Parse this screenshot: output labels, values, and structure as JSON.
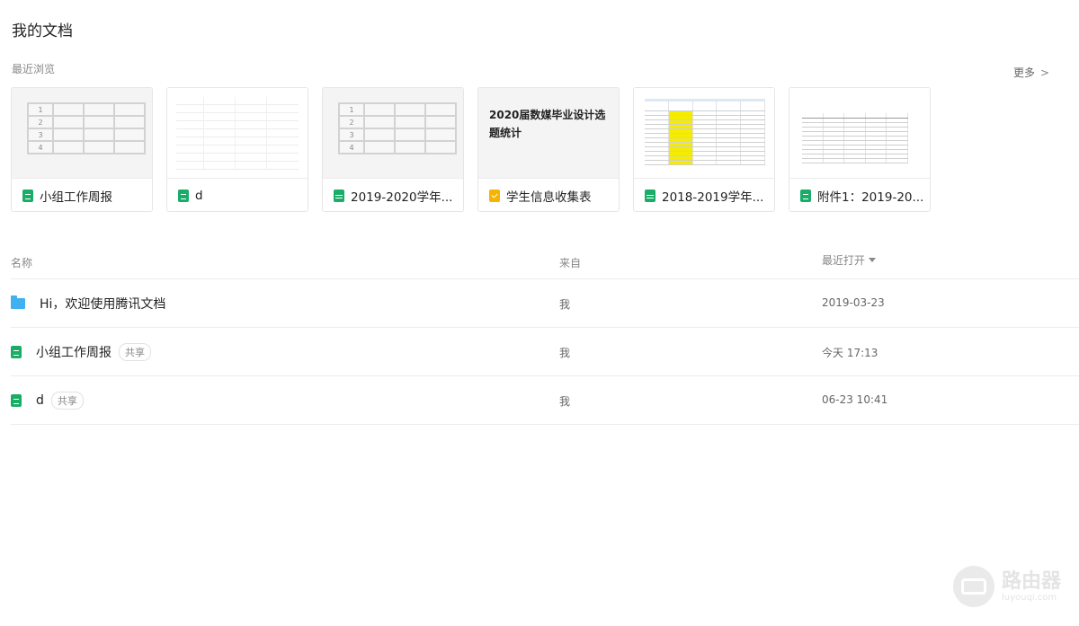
{
  "page_title": "我的文档",
  "recent": {
    "label": "最近浏览",
    "more": "更多",
    "cards": [
      {
        "name": "小组工作周报",
        "icon": "sheet-icon"
      },
      {
        "name": "d",
        "icon": "sheet-icon"
      },
      {
        "name": "2019-2020学年...",
        "icon": "sheet-icon"
      },
      {
        "name": "学生信息收集表",
        "icon": "form-icon",
        "preview_text": "2020届数媒毕业设计选题统计"
      },
      {
        "name": "2018-2019学年...",
        "icon": "sheet-icon"
      },
      {
        "name": "附件1：2019-20...",
        "icon": "sheet-icon"
      }
    ],
    "grid_rows": [
      "1",
      "2",
      "3",
      "4"
    ]
  },
  "list": {
    "headers": {
      "name": "名称",
      "from": "来自",
      "opened": "最近打开"
    },
    "rows": [
      {
        "title": "Hi，欢迎使用腾讯文档",
        "icon": "folder-icon",
        "badge": "",
        "from": "我",
        "time": "2019-03-23"
      },
      {
        "title": "小组工作周报",
        "icon": "sheet-icon",
        "badge": "共享",
        "from": "我",
        "time": "今天 17:13"
      },
      {
        "title": "d",
        "icon": "sheet-icon",
        "badge": "共享",
        "from": "我",
        "time": "06-23 10:41"
      }
    ]
  },
  "watermark": {
    "title": "路由器",
    "subtitle": "luyouqi.com"
  },
  "colors": {
    "sheet": "#1aad68",
    "form": "#f5b400",
    "folder": "#3fb1f0"
  }
}
